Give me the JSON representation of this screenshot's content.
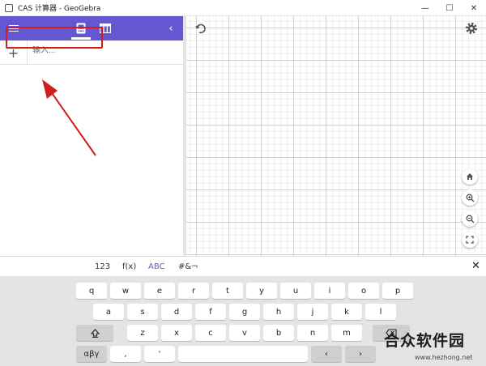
{
  "window": {
    "title": "CAS 计算器 - GeoGebra",
    "controls": [
      "—",
      "☐",
      "✕"
    ]
  },
  "algebra": {
    "add_symbol": "+",
    "input_placeholder": "输入...",
    "collapse_symbol": "‹"
  },
  "keyboard": {
    "tabs": [
      "123",
      "f(x)",
      "ABC",
      "#&¬"
    ],
    "active_tab": "ABC",
    "close_symbol": "✕",
    "rows": [
      [
        "q",
        "w",
        "e",
        "r",
        "t",
        "y",
        "u",
        "i",
        "o",
        "p"
      ],
      [
        "a",
        "s",
        "d",
        "f",
        "g",
        "h",
        "j",
        "k",
        "l"
      ],
      [
        "z",
        "x",
        "c",
        "v",
        "b",
        "n",
        "m"
      ]
    ],
    "bottom": {
      "greek": "αβγ",
      "comma": ",",
      "quote": "'",
      "left": "‹",
      "right": "›"
    }
  },
  "watermark": {
    "text": "合众软件园",
    "url": "www.hezhong.net"
  },
  "colors": {
    "accent": "#6557d2",
    "annotation": "#d21d1d"
  }
}
